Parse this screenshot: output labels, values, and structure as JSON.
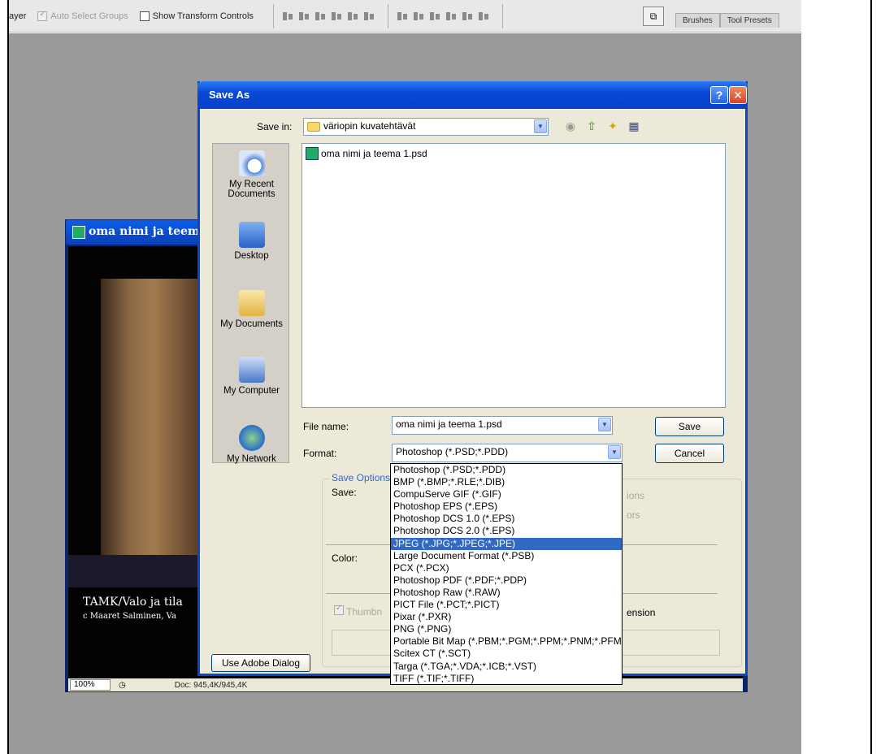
{
  "options_bar": {
    "layer_fragment": "ayer",
    "auto_select_groups": "Auto Select Groups",
    "show_transform_controls": "Show Transform Controls"
  },
  "palette_tabs": [
    "Brushes",
    "Tool Presets"
  ],
  "document": {
    "title": "oma nimi ja teema",
    "caption_line1": "TAMK/Valo ja tila",
    "caption_line2": "c Maaret Salminen, Va",
    "zoom": "100%",
    "doc_size": "Doc: 945,4K/945,4K"
  },
  "dialog": {
    "title": "Save As",
    "save_in_label": "Save in:",
    "save_in_value": "väriopin kuvatehtävät",
    "places": [
      "My Recent Documents",
      "Desktop",
      "My Documents",
      "My Computer",
      "My Network"
    ],
    "files": [
      "oma nimi ja teema 1.psd"
    ],
    "file_name_label": "File name:",
    "file_name_value": "oma nimi ja teema 1.psd",
    "format_label": "Format:",
    "format_value": "Photoshop (*.PSD;*.PDD)",
    "save_button": "Save",
    "cancel_button": "Cancel",
    "save_options_legend": "Save Options",
    "save_label": "Save:",
    "color_label": "Color:",
    "thumbnail_fragment": "Thumbn",
    "extension_fragment": "ension",
    "options_fragment1": "ions",
    "options_fragment2": "ors",
    "use_adobe_dialog": "Use Adobe Dialog",
    "help_glyph": "?",
    "close_glyph": "✕"
  },
  "format_options": [
    "Photoshop (*.PSD;*.PDD)",
    "BMP (*.BMP;*.RLE;*.DIB)",
    "CompuServe GIF (*.GIF)",
    "Photoshop EPS (*.EPS)",
    "Photoshop DCS 1.0 (*.EPS)",
    "Photoshop DCS 2.0 (*.EPS)",
    "JPEG (*.JPG;*.JPEG;*.JPE)",
    "Large Document Format (*.PSB)",
    "PCX (*.PCX)",
    "Photoshop PDF (*.PDF;*.PDP)",
    "Photoshop Raw (*.RAW)",
    "PICT File (*.PCT;*.PICT)",
    "Pixar (*.PXR)",
    "PNG (*.PNG)",
    "Portable Bit Map (*.PBM;*.PGM;*.PPM;*.PNM;*.PFM",
    "Scitex CT (*.SCT)",
    "Targa (*.TGA;*.VDA;*.ICB;*.VST)",
    "TIFF (*.TIF;*.TIFF)"
  ],
  "selected_format_index": 6,
  "colors": {
    "title_blue": "#0849d8",
    "selection": "#316ac5",
    "workspace": "#9a9a9a",
    "dialog_bg": "#ece9d8"
  }
}
